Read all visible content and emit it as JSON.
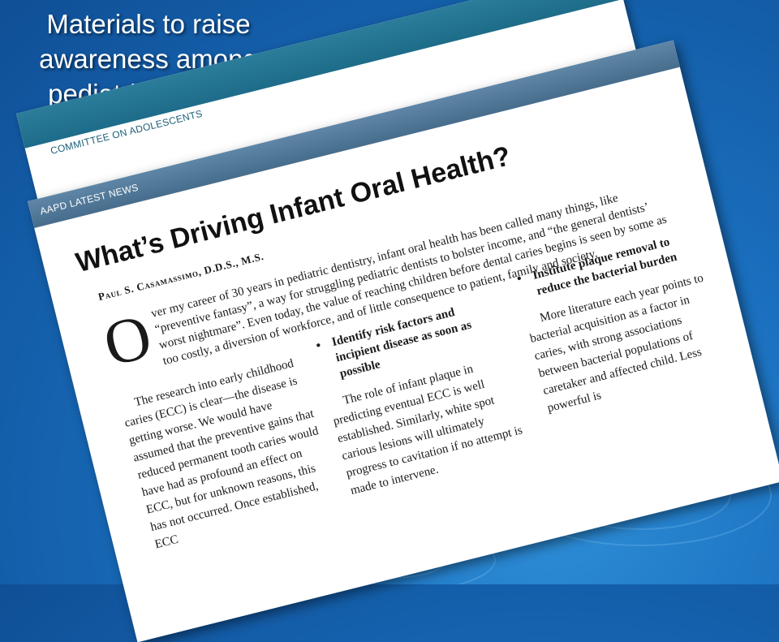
{
  "slide": {
    "title_lines": [
      "Materials to raise",
      "awareness among",
      "pediatric dentists"
    ]
  },
  "back_page": {
    "header": "COMMITTEE ON ADOLESCENTS"
  },
  "article": {
    "header": "AAPD LATEST NEWS",
    "title": "What’s Driving Infant Oral Health?",
    "byline": "Paul S. Casamassimo, D.D.S., M.S.",
    "dropcap": "O",
    "intro": "ver my career of 30 years in pediatric dentistry, infant oral health has been called many things, like “preventive fantasy”, a way for struggling pediatric dentists to bolster income, and “the general dentists’ worst nightmare”. Even today, the value of reaching children before dental caries begins is seen by some as too costly, a diversion of workforce, and of little consequence to patient, family and society.",
    "col1": "The research into early childhood caries (ECC) is clear—the disease is getting worse. We would have assumed that the preventive gains that reduced permanent tooth caries would have had as profound an effect on ECC, but for unknown reasons, this has not occurred. Once established, ECC",
    "col2_heading": "Identify risk factors and incipient disease as soon as possible",
    "col2": "The role of infant plaque in predicting eventual ECC is well established. Similarly, white spot carious lesions will ultimately progress to cavitation if no attempt is made to intervene.",
    "col3_heading": "Institute plaque removal to reduce the bacterial burden",
    "col3": "More literature each year points to bacterial acquisition as a factor in caries, with strong associations between bacterial populations of caretaker and affected child. Less powerful is"
  },
  "colors": {
    "background": "#1a6fbe",
    "back_band": "#1d6c8a",
    "front_band": "#476d8d"
  }
}
